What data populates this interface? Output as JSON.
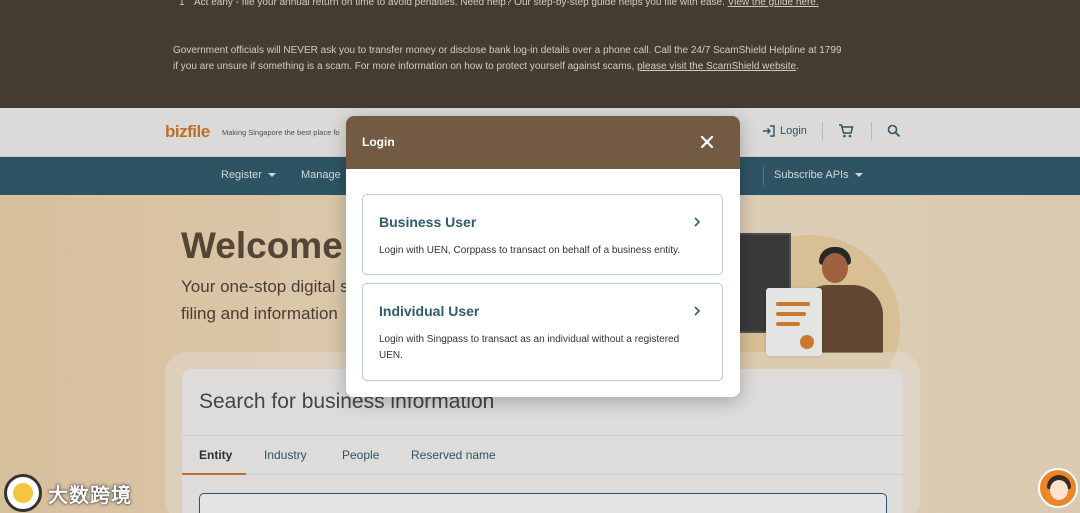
{
  "notice": {
    "item1_number": "1",
    "item1_text": "Act early - file your annual return on time to avoid penalties. Need help? Our step-by-step guide helps you file with ease.",
    "item1_link": "View the guide here.",
    "scam_text": "Government officials will NEVER ask you to transfer money or disclose bank log-in details over a phone call. Call the 24/7 ScamShield Helpline at 1799 if you are unsure if something is a scam. For more information on how to protect yourself against scams,",
    "scam_link": "please visit the ScamShield website",
    "scam_end": "."
  },
  "header": {
    "logo": "bizfile",
    "tagline": "Making Singapore the best place fo",
    "login_label": "Login"
  },
  "nav": {
    "items": [
      "Register",
      "Manage",
      "Subscribe APIs"
    ]
  },
  "hero": {
    "welcome": "Welcome t",
    "subtitle_line1": "Your one-stop digital s",
    "subtitle_line2": "filing and information"
  },
  "search_card": {
    "title": "Search for business information",
    "tabs": [
      "Entity",
      "Industry",
      "People",
      "Reserved name"
    ],
    "active_tab": "Entity"
  },
  "modal": {
    "title": "Login",
    "options": [
      {
        "title": "Business User",
        "description": "Login with UEN, Corppass to transact on behalf of a business entity."
      },
      {
        "title": "Individual User",
        "description": "Login with Singpass to transact as an individual without a registered UEN."
      }
    ]
  },
  "watermark": {
    "text": "大数跨境"
  },
  "colors": {
    "notice_bg": "#4b3f33",
    "nav_bg": "#2f5c6e",
    "modal_header_bg": "#735a43",
    "accent_orange": "#d27a2b"
  }
}
